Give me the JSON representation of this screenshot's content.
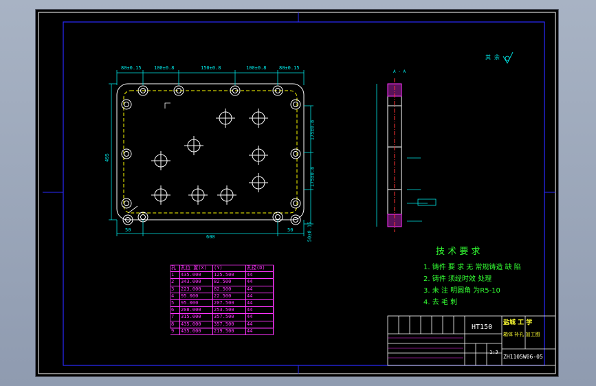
{
  "surface_finish": {
    "label": "其 余"
  },
  "section_label": "A - A",
  "tech_requirements": {
    "title": "技 术 要 求",
    "items": [
      "1. 铸件 要 求 无 常规铸造 缺 陷",
      "2. 铸件 须经时效 处理",
      "3. 未 注 明圆角 为R5-10",
      "4. 去 毛 刺"
    ]
  },
  "hole_table": {
    "headers": [
      "孔 号",
      "孔位 置(X)",
      "(Y)",
      "孔径(D)"
    ],
    "rows": [
      [
        "1",
        "435.000",
        "125.500",
        "44"
      ],
      [
        "2",
        "343.000",
        "82.500",
        "44"
      ],
      [
        "3",
        "223.000",
        "82.500",
        "44"
      ],
      [
        "4",
        "95.000",
        "22.500",
        "44"
      ],
      [
        "5",
        "95.000",
        "207.500",
        "44"
      ],
      [
        "6",
        "208.000",
        "253.500",
        "44"
      ],
      [
        "7",
        "315.000",
        "357.500",
        "44"
      ],
      [
        "8",
        "435.000",
        "357.500",
        "44"
      ],
      [
        "9",
        "435.000",
        "219.500",
        "44"
      ]
    ]
  },
  "title_block": {
    "material": "HT150",
    "school": "盐城 工 学",
    "part_name": "箱体 补孔 加工图",
    "scale": "1:3",
    "drawing_no": "ZH1105W06-05"
  },
  "dims": {
    "top": [
      "80±0.15",
      "100±0.8",
      "150±0.8",
      "100±0.8",
      "80±0.15"
    ],
    "left": "495",
    "right": [
      "175±0.8",
      "175±0.8",
      "50±0.15"
    ],
    "bottom": [
      "50",
      "600",
      "50"
    ]
  },
  "colors": {
    "background": "#000000",
    "border": "#2a2aff",
    "lines": "#ffffff",
    "dimensions": "#00e5e5",
    "table": "#ff33ff",
    "text_green": "#33ff33",
    "text_yellow": "#ffff33",
    "hatch": "#ff33ff",
    "dashed": "#ffff00"
  }
}
